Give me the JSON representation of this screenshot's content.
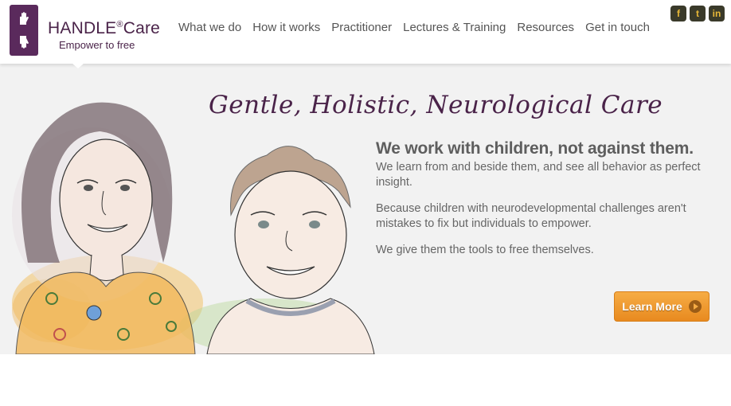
{
  "header": {
    "brand": "HANDLE",
    "brand_suffix": "Care",
    "registered_mark": "®",
    "tagline": "Empower to free",
    "logo_color": "#5a2a5c"
  },
  "nav": {
    "items": [
      {
        "label": "What we do"
      },
      {
        "label": "How it works"
      },
      {
        "label": "Practitioner"
      },
      {
        "label": "Lectures & Training"
      },
      {
        "label": "Resources"
      },
      {
        "label": "Get in touch"
      }
    ]
  },
  "social": {
    "facebook": "f",
    "twitter": "t",
    "linkedin": "in",
    "icons": [
      "facebook-icon",
      "twitter-icon",
      "linkedin-icon"
    ]
  },
  "hero": {
    "handwritten_title": "Gentle, Holistic, Neurological Care",
    "headline": "We work with children, not against them.",
    "paragraphs": [
      "We learn from and beside them, and see all behavior as perfect insight.",
      "Because children with neurodevelopmental challenges aren't mistakes to fix but individuals to empower.",
      "We give them the tools to free themselves."
    ],
    "cta_label": "Learn More",
    "cta_color": "#f0a030",
    "background": "#f2f2f2"
  }
}
